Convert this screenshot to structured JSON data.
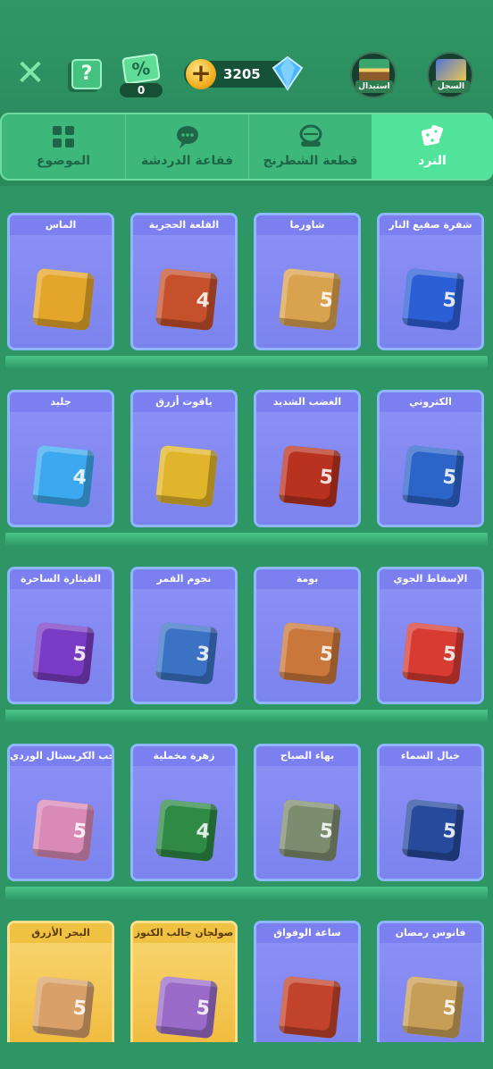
{
  "header": {
    "discount_count": "0",
    "discount_symbol": "%",
    "coins": "3205",
    "shop_label": "استبدال",
    "history_label": "السجل",
    "help_symbol": "?",
    "close_symbol": "✕",
    "coin_plus": "+"
  },
  "tabs": [
    {
      "label": "الموضوع",
      "icon": "grid-icon"
    },
    {
      "label": "فقاعة الدردشة",
      "icon": "chat-bubble-icon"
    },
    {
      "label": "قطعة الشطرنج",
      "icon": "game-piece-icon"
    },
    {
      "label": "النرد",
      "icon": "dice-icon",
      "active": true
    }
  ],
  "items": [
    {
      "title": "شفرة صقيع النار",
      "color": "#2c5fd6",
      "num": "5"
    },
    {
      "title": "شاورما",
      "color": "#d9a24e",
      "num": "5"
    },
    {
      "title": "القلعة الحجرية",
      "color": "#c5512c",
      "num": "4"
    },
    {
      "title": "الماس",
      "color": "#e4a52b",
      "num": ""
    },
    {
      "title": "الكتروني",
      "color": "#2d64c8",
      "num": "5"
    },
    {
      "title": "الغضب الشديد",
      "color": "#b8321f",
      "num": "5"
    },
    {
      "title": "ياقوت أزرق",
      "color": "#e0b52b",
      "num": ""
    },
    {
      "title": "جليد",
      "color": "#3ca8ef",
      "num": "4"
    },
    {
      "title": "الإسقاط الجوي",
      "color": "#d73b32",
      "num": "5"
    },
    {
      "title": "بومة",
      "color": "#c9773a",
      "num": "5"
    },
    {
      "title": "نجوم القمر",
      "color": "#3b72c4",
      "num": "3"
    },
    {
      "title": "القيثارة الساحرة",
      "color": "#7a3cc4",
      "num": "5"
    },
    {
      "title": "خيال السماء",
      "color": "#274a9c",
      "num": "5"
    },
    {
      "title": "بهاء الصباح",
      "color": "#7c8c6e",
      "num": "5"
    },
    {
      "title": "زهرة مخملية",
      "color": "#2e8a45",
      "num": "4"
    },
    {
      "title": "حب الكريستال الوردي",
      "color": "#d98ab6",
      "num": "5"
    },
    {
      "title": "فانوس رمضان",
      "color": "#c79e57",
      "num": "5"
    },
    {
      "title": "ساعة الوفواق",
      "color": "#c2432b",
      "num": ""
    },
    {
      "title": "صولجان جالب الكنوز",
      "color": "#9b6bc9",
      "num": "5",
      "gold": true
    },
    {
      "title": "البحر الأزرق",
      "color": "#d9a06a",
      "num": "5",
      "gold": true
    }
  ]
}
